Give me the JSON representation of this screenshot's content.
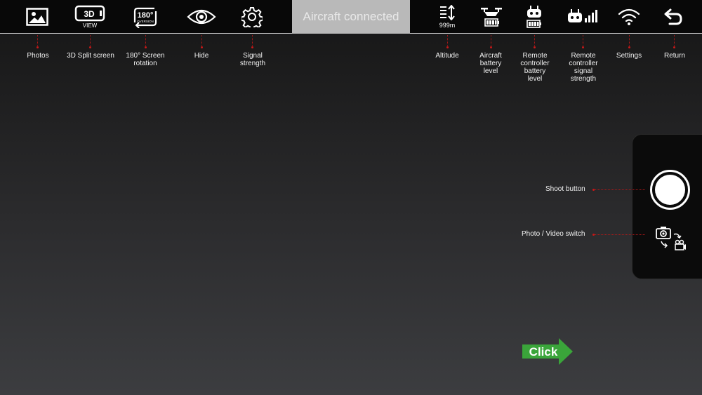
{
  "topbar": {
    "status_tab": "Aircraft connected",
    "split_icon_text": "3D",
    "split_icon_sub": "VIEW",
    "rotate_icon_text": "180°",
    "rotate_icon_sub": "OVERSION",
    "altitude_value": "999m"
  },
  "labels": {
    "photos": "Photos",
    "split_screen": "3D Split screen",
    "rotation": "180° Screen\nrotation",
    "hide": "Hide",
    "signal": "Signal\nstrength",
    "altitude": "Altitude",
    "aircraft_battery": "Aircraft\nbattery\nlevel",
    "remote_battery": "Remote\ncontroller\nbattery\nlevel",
    "remote_signal": "Remote\ncontroller\nsignal\nstrength",
    "settings": "Settings",
    "return": "Return"
  },
  "side": {
    "shoot_label": "Shoot button",
    "switch_label": "Photo / Video switch"
  },
  "click_hint": "Click",
  "colors": {
    "topbar_bg": "#080808",
    "status_tab_bg": "#b9b9b9",
    "connector": "#c81818",
    "click_green": "#3aa53a"
  },
  "icons": {
    "photos": "image-icon",
    "split": "3d-view-icon",
    "rotation": "rotate-180-icon",
    "hide": "eye-icon",
    "signal_strength": "gear-icon",
    "altitude": "altitude-icon",
    "aircraft_battery": "drone-battery-icon",
    "remote_battery": "remote-battery-icon",
    "remote_signal": "remote-signal-icon",
    "settings": "wifi-icon",
    "return": "return-icon"
  }
}
